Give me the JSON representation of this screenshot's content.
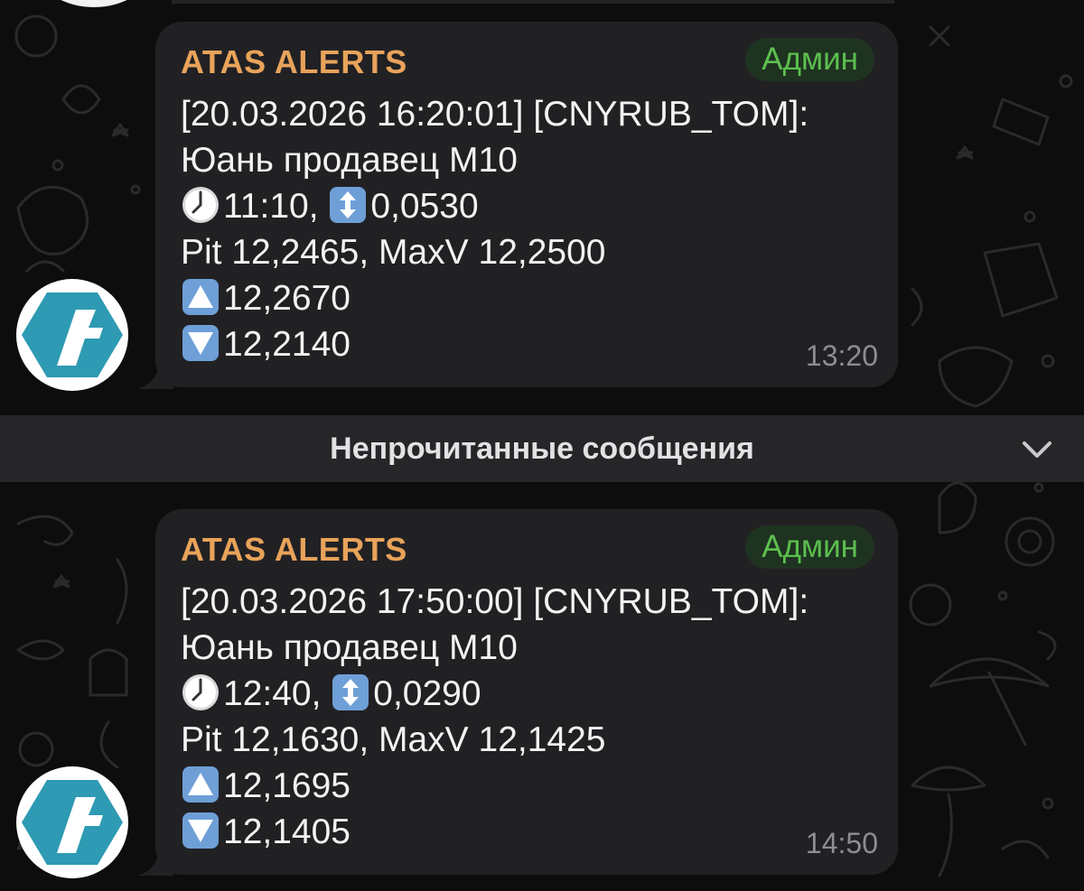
{
  "chat": {
    "unread_divider": "Непрочитанные сообщения",
    "messages": [
      {
        "sender": "ATAS ALERTS",
        "badge": "Админ",
        "line1": "[20.03.2026 16:20:01] [CNYRUB_TOM]:",
        "line2": "Юань продавец M10",
        "clock_time": "11:10,",
        "range": "0,0530",
        "line4": "Pit 12,2465, MaxV 12,2500",
        "up_value": "12,2670",
        "down_value": "12,2140",
        "time": "13:20"
      },
      {
        "sender": "ATAS ALERTS",
        "badge": "Админ",
        "line1": "[20.03.2026 17:50:00] [CNYRUB_TOM]:",
        "line2": "Юань продавец M10",
        "clock_time": "12:40,",
        "range": "0,0290",
        "line4": "Pit 12,1630, MaxV 12,1425",
        "up_value": "12,1695",
        "down_value": "12,1405",
        "time": "14:50"
      }
    ]
  },
  "icons": {
    "avatar": "atas-logo-icon",
    "clock": "clock-emoji-icon",
    "updown": "up-down-arrow-emoji-icon",
    "up": "up-triangle-emoji-icon",
    "down": "down-triangle-emoji-icon",
    "chevron": "chevron-down-icon"
  },
  "colors": {
    "background": "#0d0d0e",
    "bubble": "#212124",
    "sender": "#e8a35a",
    "admin_badge_text": "#5cbf4f",
    "logo": "#2e9ab3"
  }
}
